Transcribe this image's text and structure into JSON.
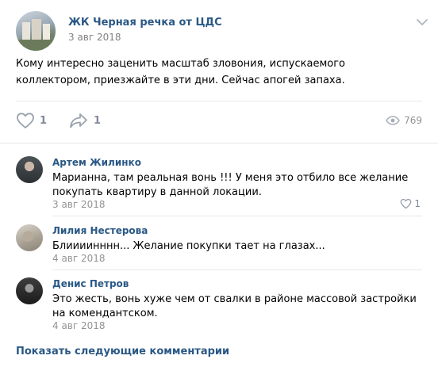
{
  "post": {
    "group_name": "ЖК Черная речка от ЦДС",
    "date": "3 авг 2018",
    "text": "Кому интересно заценить масштаб зловония, испускаемого коллектором, приезжайте в эти дни. Сейчас апогей запаха.",
    "likes": "1",
    "shares": "1",
    "views": "769"
  },
  "comments": [
    {
      "author": "Артем Жилинко",
      "text": "Марианна, там реальная вонь !!! У меня это отбило все желание покупать квартиру в данной локации.",
      "date": "3 авг 2018",
      "likes": "1"
    },
    {
      "author": "Лилия Нестерова",
      "text": "Блиииинннн... Желание покупки тает на глазах...",
      "date": "4 авг 2018"
    },
    {
      "author": "Денис Петров",
      "text": "Это жесть, вонь хуже чем от свалки в районе массовой застройки на комендантском.",
      "date": "4 авг 2018"
    }
  ],
  "show_more": "Показать следующие комментарии",
  "icons": {
    "like": "heart-icon",
    "share": "share-arrow-icon",
    "views": "eye-icon",
    "menu": "chevron-down-icon"
  },
  "colors": {
    "link": "#2a5885",
    "muted": "#828a99",
    "divider": "#e7e8ec"
  }
}
